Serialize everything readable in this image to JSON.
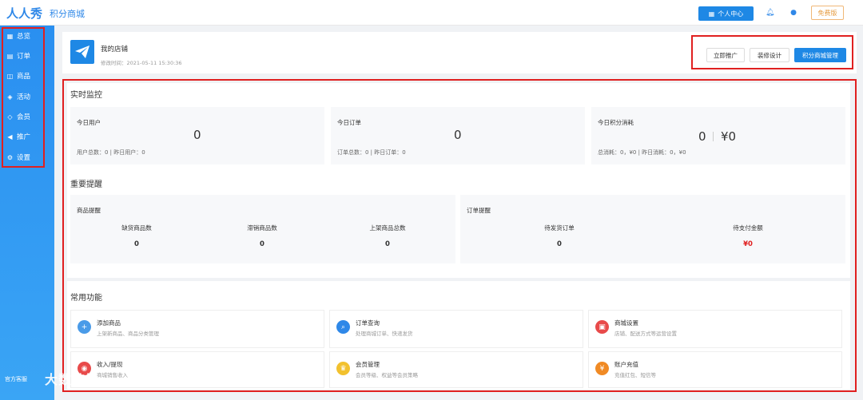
{
  "header": {
    "logo": "人人秀",
    "subtitle": "积分商城",
    "personal_center": "个人中心",
    "free_version": "免费版"
  },
  "sidebar": {
    "items": [
      {
        "label": "总览",
        "icon": "grid-icon"
      },
      {
        "label": "订单",
        "icon": "document-icon"
      },
      {
        "label": "商品",
        "icon": "bag-icon"
      },
      {
        "label": "活动",
        "icon": "tag-icon"
      },
      {
        "label": "会员",
        "icon": "diamond-icon"
      },
      {
        "label": "推广",
        "icon": "megaphone-icon"
      },
      {
        "label": "设置",
        "icon": "gear-icon"
      }
    ],
    "footer": "官方客服"
  },
  "store": {
    "name": "我的店铺",
    "modified": "修改时间：2021-05-11 15:30:36",
    "actions": [
      "立即推广",
      "装修设计",
      "积分商城管理"
    ]
  },
  "monitor": {
    "title": "实时监控",
    "cards": [
      {
        "label": "今日用户",
        "value": "0",
        "sub": "用户总数：0  |  昨日用户：0"
      },
      {
        "label": "今日订单",
        "value": "0",
        "sub": "订单总数：0  |  昨日订单：0"
      },
      {
        "label": "今日积分消耗",
        "value": "0",
        "value2": "¥0",
        "sub": "总消耗：0，¥0  |  昨日消耗：0，¥0"
      }
    ]
  },
  "reminders": {
    "title": "重要提醒",
    "goods": {
      "label": "商品提醒",
      "metrics": [
        {
          "label": "缺货商品数",
          "value": "0"
        },
        {
          "label": "滞销商品数",
          "value": "0"
        },
        {
          "label": "上架商品总数",
          "value": "0"
        }
      ]
    },
    "orders": {
      "label": "订单提醒",
      "metrics": [
        {
          "label": "待发货订单",
          "value": "0"
        },
        {
          "label": "待支付金额",
          "value": "¥0"
        }
      ]
    }
  },
  "functions": {
    "title": "常用功能",
    "items": [
      {
        "title": "添加商品",
        "desc": "上架新商品、商品分类管理",
        "color": "#4a9be8",
        "icon": "plus-icon"
      },
      {
        "title": "订单查询",
        "desc": "处理商城订单、快递发货",
        "color": "#2f88e8",
        "icon": "search-icon"
      },
      {
        "title": "商城设置",
        "desc": "店铺、配送方式等运营设置",
        "color": "#e84a4a",
        "icon": "store-icon"
      },
      {
        "title": "收入/提现",
        "desc": "商城销售收入",
        "color": "#e84a4a",
        "icon": "wallet-icon"
      },
      {
        "title": "会员管理",
        "desc": "会员等级、权益等会员策略",
        "color": "#f2c12e",
        "icon": "crown-icon"
      },
      {
        "title": "账户充值",
        "desc": "充值红包、短信等",
        "color": "#f08a24",
        "icon": "coin-icon"
      }
    ]
  },
  "colors": {
    "primary": "#1e88e5",
    "highlight_border": "#e02020",
    "sidebar": "#2a8ff0"
  },
  "watermark": "大数跨境"
}
